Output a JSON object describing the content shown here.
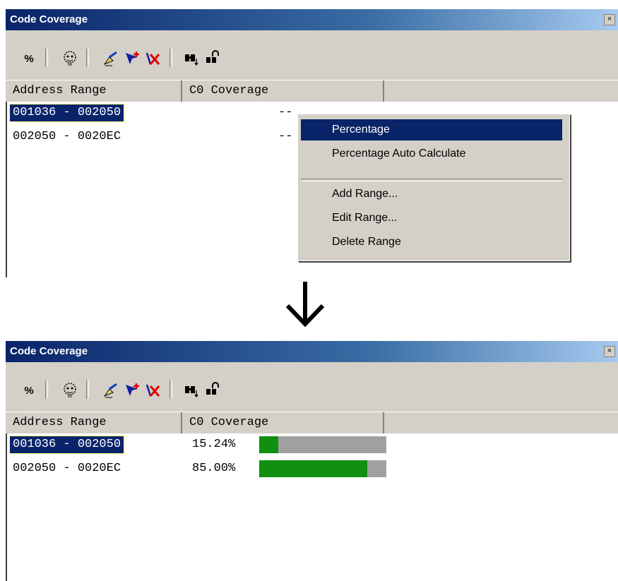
{
  "window_title": "Code Coverage",
  "close_glyph": "×",
  "toolbar": {
    "percent_label": "%"
  },
  "columns": [
    "Address Range",
    "C0 Coverage"
  ],
  "top_panel": {
    "rows": [
      {
        "range": "001036 - 002050",
        "coverage": "--",
        "selected": true
      },
      {
        "range": "002050 - 0020EC",
        "coverage": "--",
        "selected": false
      }
    ]
  },
  "context_menu": {
    "items": [
      "Percentage",
      "Percentage Auto Calculate",
      "Add Range...",
      "Edit Range...",
      "Delete Range"
    ],
    "highlighted": "Percentage"
  },
  "bottom_panel": {
    "rows": [
      {
        "range": "001036 - 002050",
        "percent_text": "15.24%",
        "fraction": 0.1524,
        "selected": true
      },
      {
        "range": "002050 - 0020EC",
        "percent_text": "85.00%",
        "fraction": 0.85,
        "selected": false
      }
    ]
  },
  "colors": {
    "title_bar": "#0a246a",
    "selection": "#0a246a",
    "bar_fill": "#118f11",
    "bar_empty": "#a0a0a0",
    "dialog_bg": "#d4d0c8"
  },
  "icons": [
    "percent-icon",
    "mask-icon",
    "hand-pen-icon",
    "add-range-icon",
    "delete-range-icon",
    "find-icon",
    "lock-icon",
    "down-arrow-icon"
  ]
}
